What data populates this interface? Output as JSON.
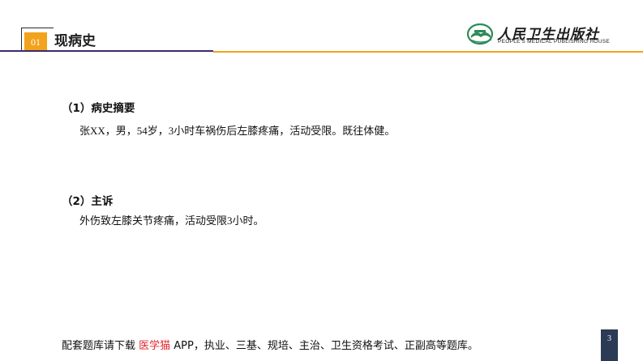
{
  "header": {
    "section_number": "01",
    "section_title": "现病史",
    "logo": {
      "name_cn": "人民卫生出版社",
      "name_en": "PEOPLE'S MEDICAL PUBLISHING HOUSE",
      "icon": "book-emblem-icon",
      "colors": {
        "green": "#2e8b57",
        "dark": "#1a1a1a"
      }
    }
  },
  "content": {
    "summary": {
      "heading": "（1）病史摘要",
      "text": "张XX，男，54岁，3小时车祸伤后左膝疼痛，活动受限。既往体健。"
    },
    "complaint": {
      "heading": "（2）主诉",
      "text": "外伤致左膝关节疼痛，活动受限3小时。"
    }
  },
  "footer": {
    "prefix": "配套题库请下载 ",
    "highlight": "医学猫",
    "suffix": " APP，执业、三基、规培、主治、卫生资格考试、正副高等题库。",
    "page_number": "3"
  },
  "colors": {
    "accent_orange": "#f2a21b",
    "rule_dark": "#3b2a6d",
    "highlight_red": "#e0262b",
    "badge": "#2b3a55"
  }
}
